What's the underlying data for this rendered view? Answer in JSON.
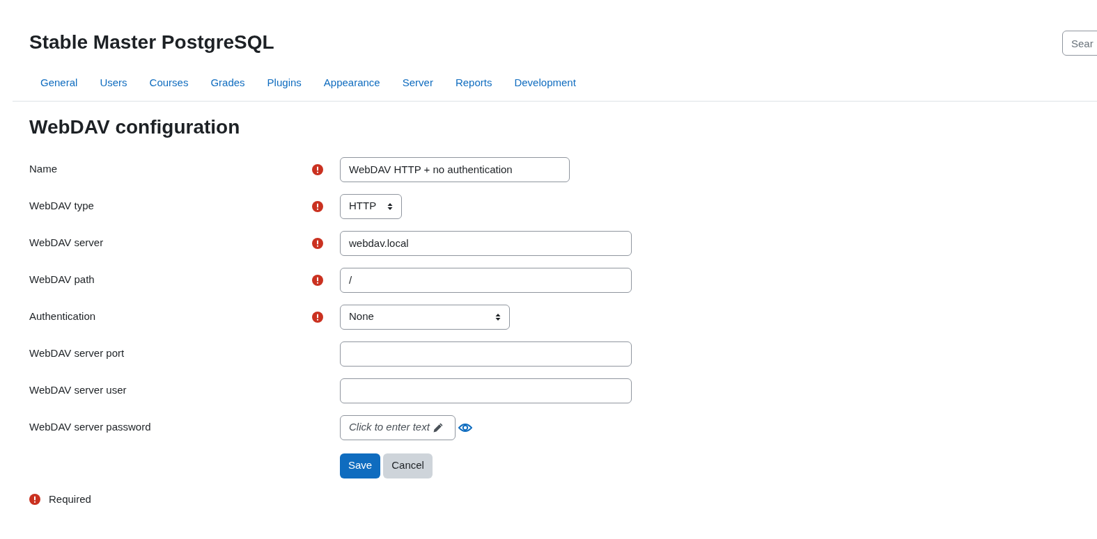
{
  "site_title": "Stable Master PostgreSQL",
  "search": {
    "placeholder": "Sear"
  },
  "nav": [
    "General",
    "Users",
    "Courses",
    "Grades",
    "Plugins",
    "Appearance",
    "Server",
    "Reports",
    "Development"
  ],
  "heading": "WebDAV configuration",
  "fields": [
    {
      "label": "Name",
      "required": true,
      "kind": "text",
      "value": "WebDAV HTTP + no authentication"
    },
    {
      "label": "WebDAV type",
      "required": true,
      "kind": "select",
      "value": "HTTP"
    },
    {
      "label": "WebDAV server",
      "required": true,
      "kind": "text",
      "value": "webdav.local"
    },
    {
      "label": "WebDAV path",
      "required": true,
      "kind": "text",
      "value": "/"
    },
    {
      "label": "Authentication",
      "required": true,
      "kind": "select",
      "value": "None"
    },
    {
      "label": "WebDAV server port",
      "required": false,
      "kind": "text"
    },
    {
      "label": "WebDAV server user",
      "required": false,
      "kind": "text"
    },
    {
      "label": "WebDAV server password",
      "required": false,
      "kind": "password",
      "value": "Click to enter text"
    }
  ],
  "buttons": {
    "save": "Save",
    "cancel": "Cancel"
  },
  "required_note": "Required"
}
